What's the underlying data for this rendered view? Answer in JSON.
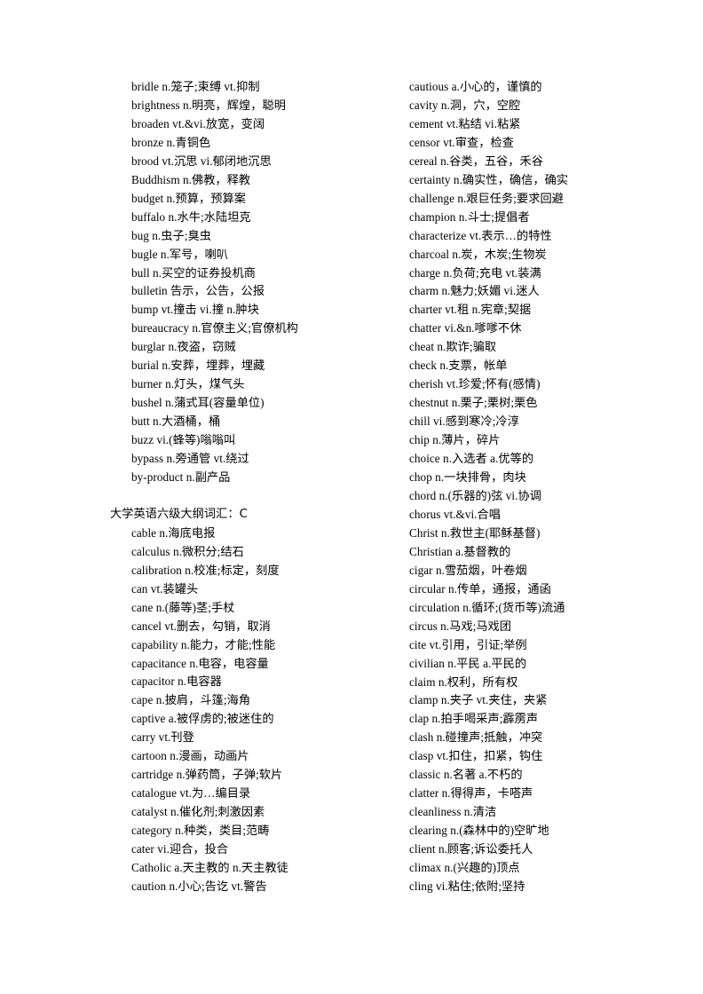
{
  "document": {
    "title": "大学英语六级大纲词汇",
    "page_background": "#ffffff",
    "text_color": "#000000"
  },
  "columns": {
    "left": [
      {
        "type": "entry",
        "text": "bridle n.笼子;束缚  vt.抑制"
      },
      {
        "type": "entry",
        "text": "brightness n.明亮，辉煌，聪明"
      },
      {
        "type": "entry",
        "text": "broaden vt.&vi.放宽，变阔"
      },
      {
        "type": "entry",
        "text": "bronze n.青铜色"
      },
      {
        "type": "entry",
        "text": "brood vt.沉思 vi.郁闭地沉思"
      },
      {
        "type": "entry",
        "text": "Buddhism n.佛教，释教"
      },
      {
        "type": "entry",
        "text": "budget n.预算，预算案"
      },
      {
        "type": "entry",
        "text": "buffalo n.水牛;水陆坦克"
      },
      {
        "type": "entry",
        "text": "bug n.虫子;臭虫"
      },
      {
        "type": "entry",
        "text": "bugle n.军号，喇叭"
      },
      {
        "type": "entry",
        "text": "bull n.买空的证券投机商"
      },
      {
        "type": "entry",
        "text": "bulletin 告示，公告，公报"
      },
      {
        "type": "entry",
        "text": "bump vt.撞击  vi.撞  n.肿块"
      },
      {
        "type": "entry",
        "text": "bureaucracy n.官僚主义;官僚机构"
      },
      {
        "type": "entry",
        "text": "burglar n.夜盗，窃贼"
      },
      {
        "type": "entry",
        "text": "burial n.安葬，埋葬，埋藏"
      },
      {
        "type": "entry",
        "text": "burner n.灯头，煤气头"
      },
      {
        "type": "entry",
        "text": "bushel n.蒲式耳(容量单位)"
      },
      {
        "type": "entry",
        "text": "butt n.大酒桶，桶"
      },
      {
        "type": "entry",
        "text": "buzz vi.(蜂等)嗡嗡叫"
      },
      {
        "type": "entry",
        "text": "bypass n.旁通管  vt.绕过"
      },
      {
        "type": "entry",
        "text": "by-product n.副产品"
      },
      {
        "type": "blank",
        "text": ""
      },
      {
        "type": "heading",
        "text": "大学英语六级大纲词汇：C"
      },
      {
        "type": "entry",
        "text": "cable n.海底电报"
      },
      {
        "type": "entry",
        "text": "calculus n.微积分;结石"
      },
      {
        "type": "entry",
        "text": "calibration n.校准;标定，刻度"
      },
      {
        "type": "entry",
        "text": "can vt.装罐头"
      },
      {
        "type": "entry",
        "text": "cane n.(藤等)茎;手杖"
      },
      {
        "type": "entry",
        "text": "cancel vt.删去，勾销，取消"
      },
      {
        "type": "entry",
        "text": "capability n.能力，才能;性能"
      },
      {
        "type": "entry",
        "text": "capacitance n.电容，电容量"
      },
      {
        "type": "entry",
        "text": "capacitor n.电容器"
      },
      {
        "type": "entry",
        "text": "cape n.披肩，斗篷;海角"
      },
      {
        "type": "entry",
        "text": "captive a.被俘虏的;被迷住的"
      },
      {
        "type": "entry",
        "text": "carry vt.刊登"
      },
      {
        "type": "entry",
        "text": "cartoon n.漫画，动画片"
      },
      {
        "type": "entry",
        "text": "cartridge n.弹药筒，子弹;软片"
      },
      {
        "type": "entry",
        "text": "catalogue vt.为…编目录"
      },
      {
        "type": "entry",
        "text": "catalyst n.催化剂;刺激因素"
      },
      {
        "type": "entry",
        "text": "category n.种类，类目;范畴"
      },
      {
        "type": "entry",
        "text": "cater vi.迎合，投合"
      },
      {
        "type": "entry",
        "text": "Catholic a.天主教的 n.天主教徒"
      },
      {
        "type": "entry",
        "text": "caution n.小心;告讫  vt.警告"
      }
    ],
    "right": [
      {
        "type": "entry",
        "text": "cautious a.小心的，谨慎的"
      },
      {
        "type": "entry",
        "text": "cavity n.洞，穴，空腔"
      },
      {
        "type": "entry",
        "text": "cement vt.粘结  vi.粘紧"
      },
      {
        "type": "entry",
        "text": "censor vt.审查，检查"
      },
      {
        "type": "entry",
        "text": "cereal n.谷类，五谷，禾谷"
      },
      {
        "type": "entry",
        "text": "certainty n.确实性，确信，确实"
      },
      {
        "type": "entry",
        "text": "challenge n.艰巨任务;要求回避"
      },
      {
        "type": "entry",
        "text": "champion n.斗士;提倡者"
      },
      {
        "type": "entry",
        "text": "characterize vt.表示…的特性"
      },
      {
        "type": "entry",
        "text": "charcoal n.炭，木炭;生物炭"
      },
      {
        "type": "entry",
        "text": "charge n.负荷;充电  vt.装满"
      },
      {
        "type": "entry",
        "text": "charm n.魅力;妖媚  vi.迷人"
      },
      {
        "type": "entry",
        "text": "charter vt.租  n.宪章;契据"
      },
      {
        "type": "entry",
        "text": "chatter vi.&n.嗲嗲不休"
      },
      {
        "type": "entry",
        "text": "cheat n.欺诈;骗取"
      },
      {
        "type": "entry",
        "text": "check n.支票，帐单"
      },
      {
        "type": "entry",
        "text": "cherish vt.珍爱;怀有(感情)"
      },
      {
        "type": "entry",
        "text": "chestnut n.栗子;栗树;栗色"
      },
      {
        "type": "entry",
        "text": "chill vi.感到寒冷;冷淳"
      },
      {
        "type": "entry",
        "text": "chip n.薄片，碎片"
      },
      {
        "type": "entry",
        "text": "choice n.入选者  a.优等的"
      },
      {
        "type": "entry",
        "text": "chop n.一块排骨，肉块"
      },
      {
        "type": "entry",
        "text": "chord n.(乐器的)弦  vi.协调"
      },
      {
        "type": "entry",
        "text": "chorus vt.&vi.合唱"
      },
      {
        "type": "entry",
        "text": "Christ n.救世主(耶稣基督)"
      },
      {
        "type": "entry",
        "text": "Christian a.基督教的"
      },
      {
        "type": "entry",
        "text": "cigar n.雪茄烟，叶卷烟"
      },
      {
        "type": "entry",
        "text": "circular n.传单，通报，通函"
      },
      {
        "type": "entry",
        "text": "circulation n.循环;(货币等)流通"
      },
      {
        "type": "entry",
        "text": "circus n.马戏;马戏团"
      },
      {
        "type": "entry",
        "text": "cite vt.引用，引证;举例"
      },
      {
        "type": "entry",
        "text": "civilian n.平民  a.平民的"
      },
      {
        "type": "entry",
        "text": "claim n.权利，所有权"
      },
      {
        "type": "entry",
        "text": "clamp n.夹子  vt.夹住，夹紧"
      },
      {
        "type": "entry",
        "text": "clap n.拍手喝采声;霹雳声"
      },
      {
        "type": "entry",
        "text": "clash n.碰撞声;抵触，冲突"
      },
      {
        "type": "entry",
        "text": "clasp vt.扣住，扣紧，钩住"
      },
      {
        "type": "entry",
        "text": "classic n.名著  a.不朽的"
      },
      {
        "type": "entry",
        "text": "clatter n.得得声，卡嗒声"
      },
      {
        "type": "entry",
        "text": "cleanliness n.清洁"
      },
      {
        "type": "entry",
        "text": "clearing n.(森林中的)空旷地"
      },
      {
        "type": "entry",
        "text": "client n.顾客;诉讼委托人"
      },
      {
        "type": "entry",
        "text": "climax n.(兴趣的)顶点"
      },
      {
        "type": "entry",
        "text": "cling vi.粘住;依附;坚持"
      }
    ]
  }
}
